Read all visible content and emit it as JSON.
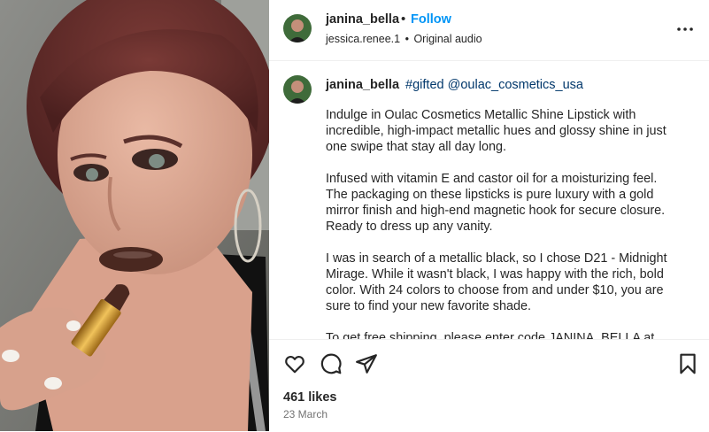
{
  "colors": {
    "accent": "#0095f6",
    "hashtag": "#00376b",
    "text": "#262626",
    "muted": "#737373"
  },
  "header": {
    "username": "janina_bella",
    "separator": "•",
    "follow_label": "Follow",
    "audio_user": "jessica.renee.1",
    "audio_separator": "•",
    "audio_label": "Original audio",
    "more_icon": "more-horizontal-icon"
  },
  "caption": {
    "username": "janina_bella",
    "hashtag": "#gifted",
    "mention": "@oulac_cosmetics_usa",
    "paragraphs": [
      "Indulge in Oulac Cosmetics Metallic Shine Lipstick with incredible, high-impact metallic hues and glossy shine in just one swipe that stay all day long.",
      "Infused with vitamin E and castor oil for a moisturizing feel. The packaging on these lipsticks is pure luxury with a gold mirror finish and high-end magnetic hook for secure closure. Ready to dress up any vanity.",
      "I was in search of a metallic black, so I chose D21 - Midnight Mirage. While it wasn't black, I was happy with the rich, bold color. With 24 colors to choose from and under $10, you are sure to find your new favorite shade.",
      "To get free shipping, please enter code JANINA_BELLA at checkout."
    ]
  },
  "actions": {
    "like_icon": "heart-icon",
    "comment_icon": "comment-icon",
    "share_icon": "share-icon",
    "save_icon": "bookmark-icon",
    "likes": "461 likes",
    "date": "23 March"
  }
}
